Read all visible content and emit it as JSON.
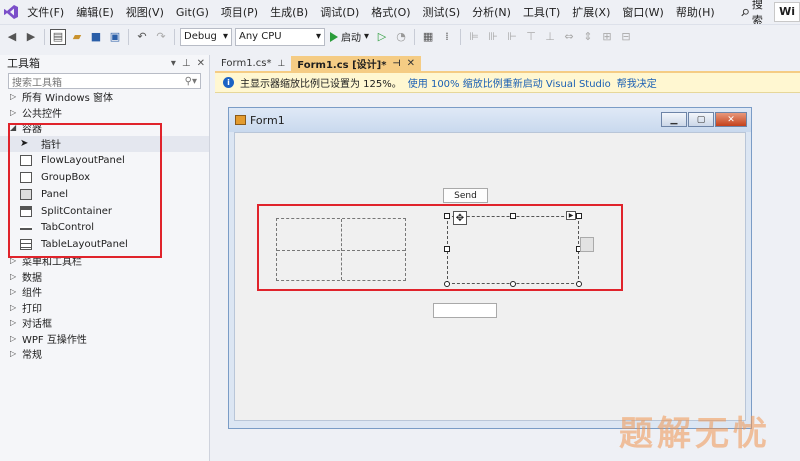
{
  "menu": {
    "items": [
      "文件(F)",
      "编辑(E)",
      "视图(V)",
      "Git(G)",
      "项目(P)",
      "生成(B)",
      "调试(D)",
      "格式(O)",
      "测试(S)",
      "分析(N)",
      "工具(T)",
      "扩展(X)",
      "窗口(W)",
      "帮助(H)"
    ],
    "search_label": "搜索",
    "window_badge": "Wi"
  },
  "toolbar": {
    "config": "Debug",
    "platform": "Any CPU",
    "start_label": "启动"
  },
  "toolbox": {
    "title": "工具箱",
    "search_placeholder": "搜索工具箱",
    "groups_before": [
      {
        "label": "所有 Windows 窗体"
      },
      {
        "label": "公共控件"
      }
    ],
    "open_group": "容器",
    "items": [
      {
        "label": "指针",
        "icon": "pointer-icon"
      },
      {
        "label": "FlowLayoutPanel",
        "icon": "flowlayoutpanel-icon"
      },
      {
        "label": "GroupBox",
        "icon": "groupbox-icon"
      },
      {
        "label": "Panel",
        "icon": "panel-icon"
      },
      {
        "label": "SplitContainer",
        "icon": "splitcontainer-icon"
      },
      {
        "label": "TabControl",
        "icon": "tabcontrol-icon"
      },
      {
        "label": "TableLayoutPanel",
        "icon": "tablelayoutpanel-icon"
      }
    ],
    "groups_after": [
      {
        "label": "菜单和工具栏"
      },
      {
        "label": "数据"
      },
      {
        "label": "组件"
      },
      {
        "label": "打印"
      },
      {
        "label": "对话框"
      },
      {
        "label": "WPF 互操作性"
      },
      {
        "label": "常规"
      }
    ]
  },
  "tabs": {
    "inactive": "Form1.cs*",
    "active": "Form1.cs [设计]*"
  },
  "infobar": {
    "message": "主显示器缩放比例已设置为 125%。",
    "link1": "使用 100% 缩放比例重新启动 Visual Studio",
    "link2": "帮我决定"
  },
  "form": {
    "title": "Form1",
    "send_label": "Send"
  },
  "colors": {
    "highlight_box": "#e0232b",
    "active_tab": "#f5cc84",
    "infobar": "#fff7d1"
  },
  "watermark": "题解无忧"
}
